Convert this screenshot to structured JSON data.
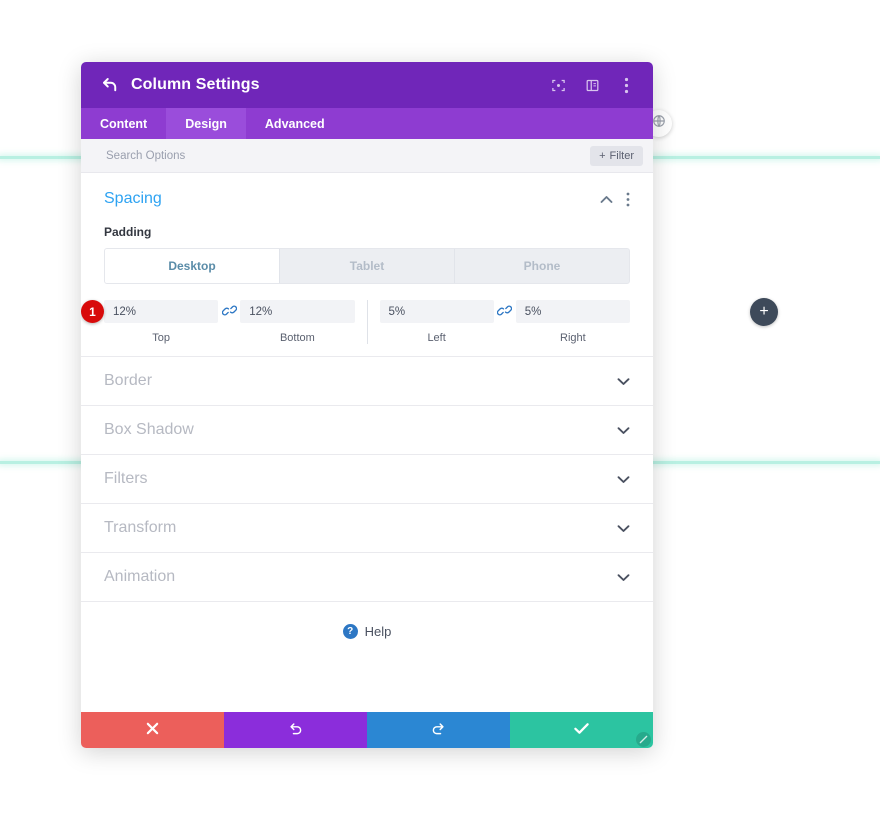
{
  "canvas": {
    "add_module_label": "+",
    "globe_icon": "globe-icon",
    "guide_color": "#b8f0e2"
  },
  "modal": {
    "title": "Column Settings",
    "back_icon": "back-arrow-icon",
    "header_icons": [
      {
        "name": "focus-mode-icon",
        "label": ""
      },
      {
        "name": "layout-panel-icon",
        "label": ""
      },
      {
        "name": "more-vertical-icon",
        "label": ""
      }
    ],
    "tabs": [
      {
        "label": "Content",
        "active": false
      },
      {
        "label": "Design",
        "active": true
      },
      {
        "label": "Advanced",
        "active": false
      }
    ],
    "search": {
      "value": "",
      "placeholder": "Search Options"
    },
    "filter_label": "Filter",
    "filter_plus": "+",
    "spacing": {
      "title": "Spacing",
      "collapse_icon": "chevron-up-icon",
      "menu_icon": "more-vertical-icon",
      "padding_label": "Padding",
      "devices": [
        {
          "label": "Desktop",
          "active": true
        },
        {
          "label": "Tablet",
          "active": false
        },
        {
          "label": "Phone",
          "active": false
        }
      ],
      "step_badge": "1",
      "fields": [
        {
          "value": "12%",
          "caption": "Top"
        },
        {
          "value": "12%",
          "caption": "Bottom"
        },
        {
          "value": "5%",
          "caption": "Left"
        },
        {
          "value": "5%",
          "caption": "Right"
        }
      ],
      "link_icon": "link-chain-icon"
    },
    "collapsed_sections": [
      {
        "title": "Border"
      },
      {
        "title": "Box Shadow"
      },
      {
        "title": "Filters"
      },
      {
        "title": "Transform"
      },
      {
        "title": "Animation"
      }
    ],
    "help": {
      "label": "Help",
      "icon_glyph": "?"
    },
    "footer": [
      {
        "name": "cancel-button",
        "icon": "close-x-icon",
        "color": "#ec5f5b"
      },
      {
        "name": "undo-button",
        "icon": "undo-icon",
        "color": "#8b2ddb"
      },
      {
        "name": "redo-button",
        "icon": "redo-icon",
        "color": "#2b87d3"
      },
      {
        "name": "save-button",
        "icon": "checkmark-icon",
        "color": "#2cc4a1"
      }
    ]
  },
  "colors": {
    "header_purple": "#7026b9",
    "tabbar_purple": "#8e3cd1",
    "active_tab_purple": "#9a4ddb",
    "accent_blue": "#2ea3f2",
    "badge_red": "#d80b0b"
  }
}
